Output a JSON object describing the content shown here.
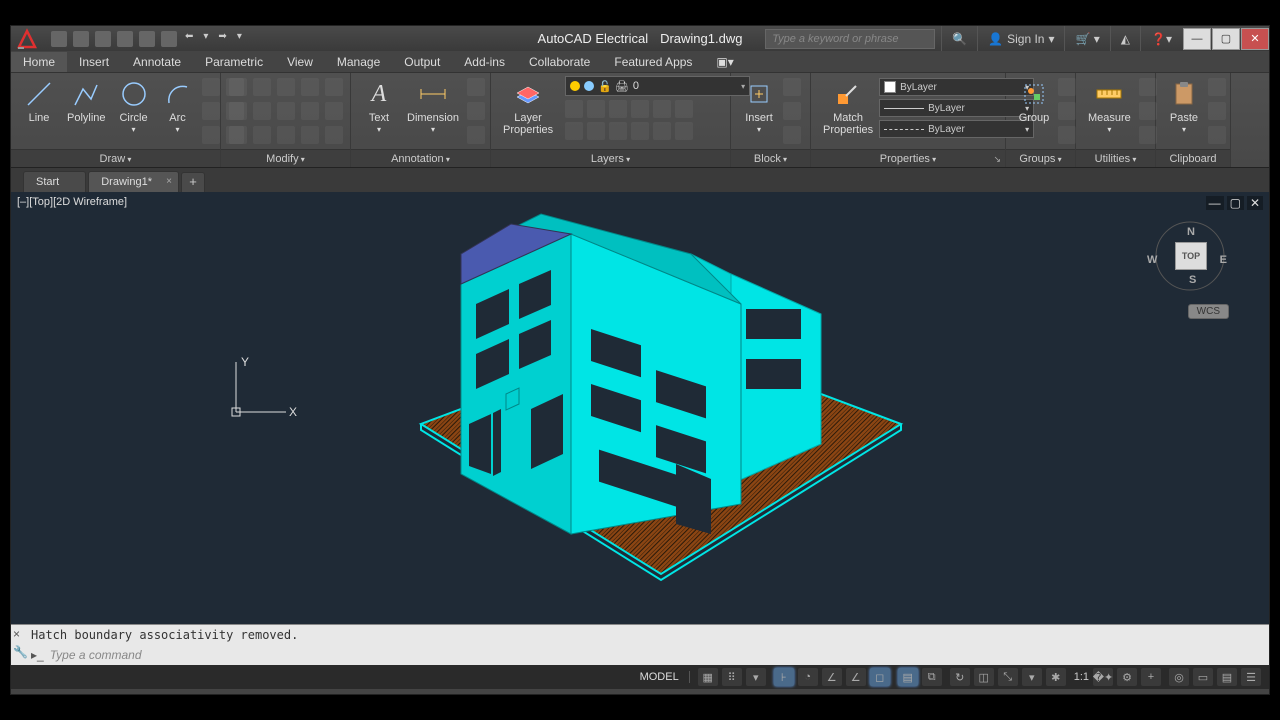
{
  "titlebar": {
    "app_name": "AutoCAD Electrical",
    "doc_name": "Drawing1.dwg",
    "search_placeholder": "Type a keyword or phrase",
    "signin": "Sign In"
  },
  "ribbon_tabs": [
    "Home",
    "Insert",
    "Annotate",
    "Parametric",
    "View",
    "Manage",
    "Output",
    "Add-ins",
    "Collaborate",
    "Featured Apps"
  ],
  "panels": {
    "draw": {
      "label": "Draw",
      "btns": [
        "Line",
        "Polyline",
        "Circle",
        "Arc"
      ]
    },
    "modify": {
      "label": "Modify"
    },
    "annotation": {
      "label": "Annotation",
      "text": "Text",
      "dim": "Dimension"
    },
    "layers": {
      "label": "Layers",
      "props": "Layer\nProperties",
      "current": "0"
    },
    "block": {
      "label": "Block",
      "insert": "Insert"
    },
    "properties": {
      "label": "Properties",
      "match": "Match\nProperties",
      "bylayer": "ByLayer"
    },
    "groups": {
      "label": "Groups",
      "group": "Group"
    },
    "utilities": {
      "label": "Utilities",
      "measure": "Measure"
    },
    "clipboard": {
      "label": "Clipboard",
      "paste": "Paste"
    }
  },
  "filetabs": {
    "start": "Start",
    "file": "Drawing1*"
  },
  "viewport": {
    "label": "[–][Top][2D Wireframe]",
    "axes": {
      "x": "X",
      "y": "Y"
    },
    "cube": {
      "top": "TOP",
      "n": "N",
      "s": "S",
      "e": "E",
      "w": "W"
    },
    "wcs": "WCS"
  },
  "command": {
    "history": "Hatch boundary associativity removed.",
    "placeholder": "Type a command",
    "chevron": "▸_"
  },
  "status": {
    "model": "MODEL",
    "scale": "1:1"
  }
}
